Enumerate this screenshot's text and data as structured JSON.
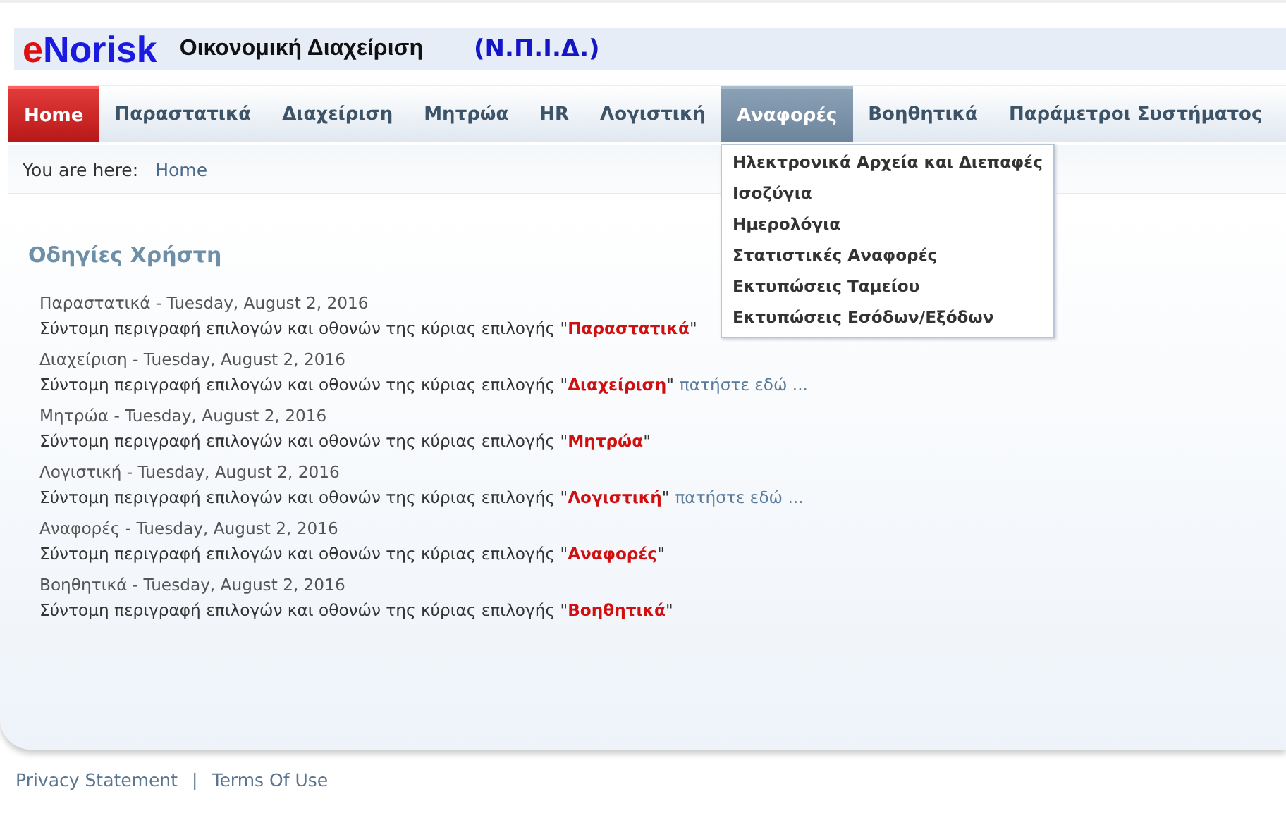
{
  "header": {
    "logo": "eNorisk",
    "title": "Οικονομική Διαχείριση",
    "org": "(Ν.Π.Ι.Δ.)"
  },
  "nav": [
    {
      "label": "Home",
      "selected": true,
      "expanded": false
    },
    {
      "label": "Παραστατικά",
      "selected": false,
      "expanded": false
    },
    {
      "label": "Διαχείριση",
      "selected": false,
      "expanded": false
    },
    {
      "label": "Μητρώα",
      "selected": false,
      "expanded": false
    },
    {
      "label": "HR",
      "selected": false,
      "expanded": false
    },
    {
      "label": "Λογιστική",
      "selected": false,
      "expanded": false
    },
    {
      "label": "Αναφορές",
      "selected": false,
      "expanded": true,
      "menu": [
        "Ηλεκτρονικά Αρχεία και Διεπαφές",
        "Ισοζύγια",
        "Ημερολόγια",
        "Στατιστικές Αναφορές",
        "Εκτυπώσεις Ταμείου",
        "Εκτυπώσεις Εσόδων/Εξόδων"
      ]
    },
    {
      "label": "Βοηθητικά",
      "selected": false,
      "expanded": false
    },
    {
      "label": "Παράμετροι Συστήματος",
      "selected": false,
      "expanded": false
    }
  ],
  "breadcrumb": {
    "label": "You are here:",
    "link": "Home"
  },
  "section_title": "Οδηγίες Χρήστη",
  "entries": [
    {
      "heading": "Παραστατικά - Tuesday, August 2, 2016",
      "description": "Σύντομη περιγραφή επιλογών και οθονών της κύριας επιλογής \"**Παραστατικά**\""
    },
    {
      "heading": "Διαχείριση - Tuesday, August 2, 2016",
      "description": "Σύντομη περιγραφή επιλογών και οθονών της κύριας επιλογής \"**Διαχείριση**\"",
      "link": "πατήστε εδώ ..."
    },
    {
      "heading": "Μητρώα - Tuesday, August 2, 2016",
      "description": "Σύντομη περιγραφή επιλογών και οθονών της κύριας επιλογής \"**Μητρώα**\""
    },
    {
      "heading": "Λογιστική - Tuesday, August 2, 2016",
      "description": "Σύντομη περιγραφή επιλογών και οθονών της κύριας επιλογής \"**Λογιστική**\"",
      "link": "πατήστε εδώ ..."
    },
    {
      "heading": "Αναφορές - Tuesday, August 2, 2016",
      "description": "Σύντομη περιγραφή επιλογών και οθονών της κύριας επιλογής \"**Αναφορές**\""
    },
    {
      "heading": "Βοηθητικά - Tuesday, August 2, 2016",
      "description": "Σύντομη περιγραφή επιλογών και οθονών της κύριας επιλογής \"**Βοηθητικά**\""
    }
  ],
  "footer": {
    "links": [
      "Privacy Statement",
      "Terms Of Use"
    ],
    "separator": "|"
  }
}
